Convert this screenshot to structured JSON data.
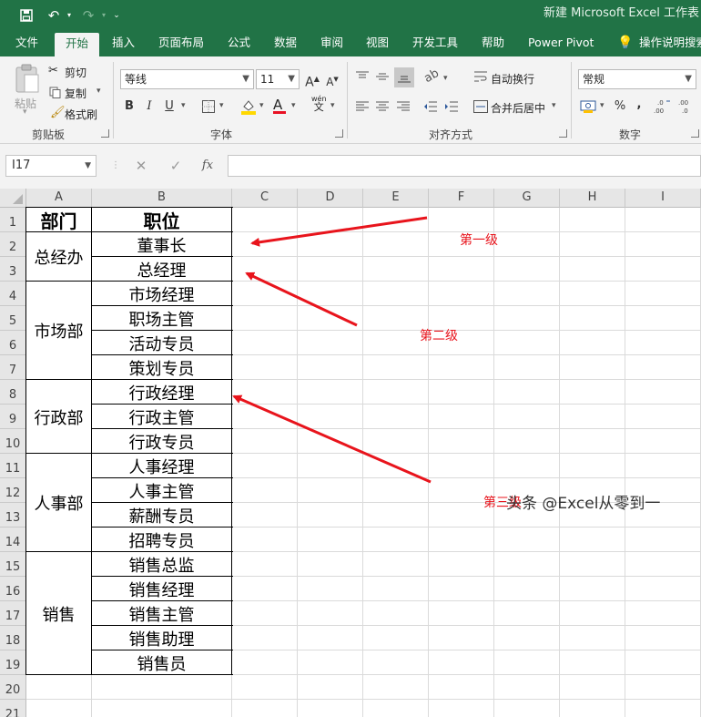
{
  "window": {
    "title": "新建 Microsoft Excel 工作表"
  },
  "ribbon_tabs": [
    "文件",
    "开始",
    "插入",
    "页面布局",
    "公式",
    "数据",
    "审阅",
    "视图",
    "开发工具",
    "帮助",
    "Power Pivot",
    "操作说明搜索"
  ],
  "active_tab": "开始",
  "clipboard": {
    "paste_label": "粘贴",
    "cut_label": "剪切",
    "copy_label": "复制",
    "format_painter_label": "格式刷",
    "group_label": "剪贴板"
  },
  "font": {
    "font_name": "等线",
    "font_size": "11",
    "bold": "B",
    "italic": "I",
    "underline": "U",
    "font_color_glyph": "A",
    "group_label": "字体",
    "phonetic_top": "wén",
    "phonetic_bottom": "文"
  },
  "alignment": {
    "wrap_text_label": "自动换行",
    "merge_center_label": "合并后居中",
    "group_label": "对齐方式"
  },
  "number": {
    "format_value": "常规",
    "percent": "%",
    "comma": ",",
    "group_label": "数字"
  },
  "formula_bar": {
    "name_box": "I17",
    "fx_label": "fx",
    "formula": ""
  },
  "grid": {
    "columns": [
      "A",
      "B",
      "C",
      "D",
      "E",
      "F",
      "G",
      "H",
      "I"
    ],
    "rows": [
      "1",
      "2",
      "3",
      "4",
      "5",
      "6",
      "7",
      "8",
      "9",
      "10",
      "11",
      "12",
      "13",
      "14",
      "15",
      "16",
      "17",
      "18",
      "19",
      "20",
      "21"
    ],
    "header_department": "部门",
    "header_position": "职位",
    "departments": [
      "总经办",
      "市场部",
      "行政部",
      "人事部",
      "销售"
    ],
    "positions": [
      "董事长",
      "总经理",
      "市场经理",
      "职场主管",
      "活动专员",
      "策划专员",
      "行政经理",
      "行政主管",
      "行政专员",
      "人事经理",
      "人事主管",
      "薪酬专员",
      "招聘专员",
      "销售总监",
      "销售经理",
      "销售主管",
      "销售助理",
      "销售员"
    ]
  },
  "annotations": {
    "level_1": "第一级",
    "level_2": "第二级",
    "level_3": "第三级",
    "arrow_color": "#e8141c"
  },
  "watermark": "头条 @Excel从零到一",
  "colors": {
    "excel_green": "#217346",
    "ribbon_bg": "#f3f3f3",
    "header_bg": "#e6e6e6"
  }
}
